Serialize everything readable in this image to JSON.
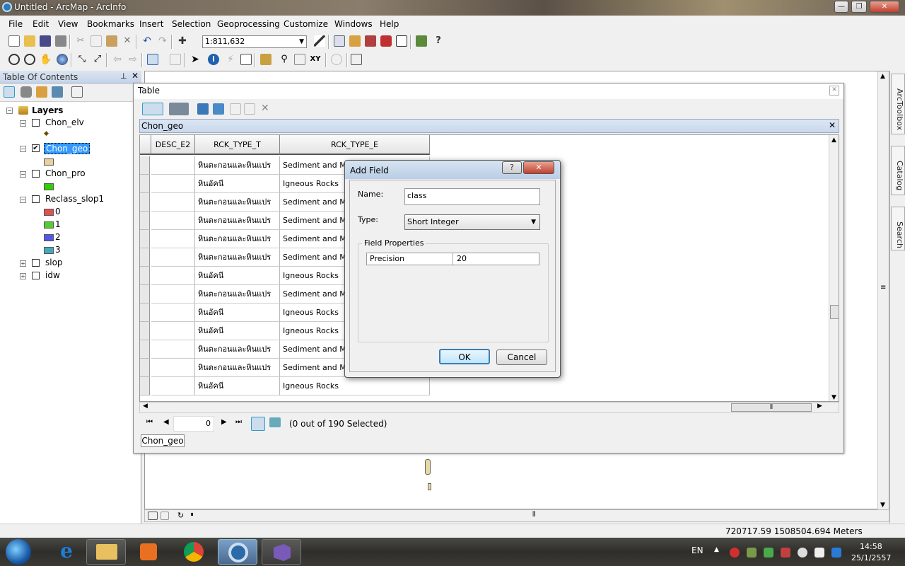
{
  "window": {
    "title": "Untitled - ArcMap - ArcInfo"
  },
  "menu": [
    "File",
    "Edit",
    "View",
    "Bookmarks",
    "Insert",
    "Selection",
    "Geoprocessing",
    "Customize",
    "Windows",
    "Help"
  ],
  "toolbar": {
    "scale": "1:811,632"
  },
  "toc": {
    "title": "Table Of Contents",
    "root": "Layers",
    "layers": [
      {
        "name": "Chon_elv",
        "checked": false
      },
      {
        "name": "Chon_geo",
        "checked": true
      },
      {
        "name": "Chon_pro",
        "checked": false
      },
      {
        "name": "Reclass_slop1",
        "checked": false
      },
      {
        "name": "slop",
        "checked": false
      },
      {
        "name": "idw",
        "checked": false
      }
    ],
    "reclass_classes": [
      {
        "label": "0",
        "color": "#e05050"
      },
      {
        "label": "1",
        "color": "#55cc33"
      },
      {
        "label": "2",
        "color": "#5555ee"
      },
      {
        "label": "3",
        "color": "#44aabb"
      }
    ]
  },
  "right_dock": [
    "ArcToolbox",
    "Catalog",
    "Search"
  ],
  "table": {
    "window_title": "Table",
    "layer_name": "Chon_geo",
    "columns": [
      "DESC_E2",
      "RCK_TYPE_T",
      "RCK_TYPE_E"
    ],
    "rows": [
      [
        "",
        "หินตะกอนและหินแปร",
        "Sediment and Met"
      ],
      [
        "",
        "หินอัคนี",
        "Igneous Rocks"
      ],
      [
        "",
        "หินตะกอนและหินแปร",
        "Sediment and Met"
      ],
      [
        "",
        "หินตะกอนและหินแปร",
        "Sediment and Met"
      ],
      [
        "",
        "หินตะกอนและหินแปร",
        "Sediment and Met"
      ],
      [
        "",
        "หินตะกอนและหินแปร",
        "Sediment and Met"
      ],
      [
        "",
        "หินอัคนี",
        "Igneous Rocks"
      ],
      [
        "",
        "หินตะกอนและหินแปร",
        "Sediment and Met"
      ],
      [
        "",
        "หินอัคนี",
        "Igneous Rocks"
      ],
      [
        "",
        "หินอัคนี",
        "Igneous Rocks"
      ],
      [
        "",
        "หินตะกอนและหินแปร",
        "Sediment and Met"
      ],
      [
        "",
        "หินตะกอนและหินแปร",
        "Sediment and Met"
      ],
      [
        "",
        "หินอัคนี",
        "Igneous Rocks"
      ]
    ],
    "record_index": "0",
    "selection_status": "(0 out of 190 Selected)",
    "tab_label": "Chon_geo"
  },
  "dialog": {
    "title": "Add Field",
    "help_label": "?",
    "close_label": "✕",
    "name_label": "Name:",
    "name_value": "class",
    "type_label": "Type:",
    "type_value": "Short Integer",
    "group_label": "Field Properties",
    "prop_name": "Precision",
    "prop_value": "20",
    "ok_label": "OK",
    "cancel_label": "Cancel"
  },
  "status": {
    "coords": "720717.59  1508504.694 Meters"
  },
  "taskbar": {
    "lang": "EN",
    "time": "14:58",
    "date": "25/1/2557"
  }
}
